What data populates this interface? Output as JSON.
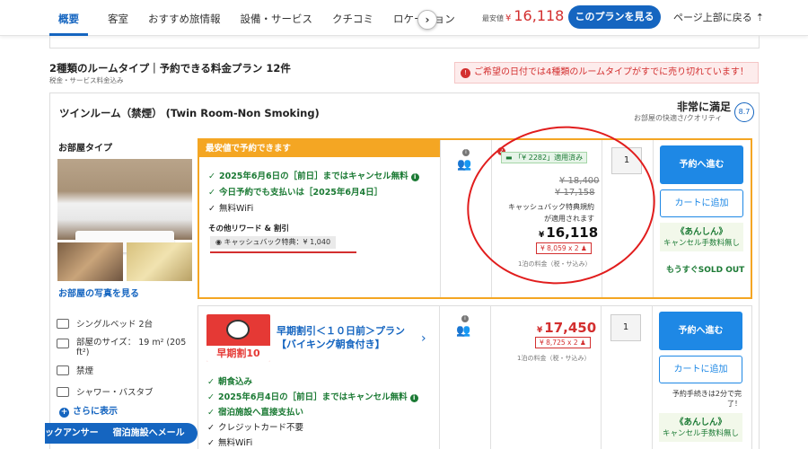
{
  "nav": {
    "tabs": [
      "概要",
      "客室",
      "おすすめ旅情報",
      "設備・サービス",
      "クチコミ",
      "ロケーション"
    ],
    "scroll_icon": "chevron-right-icon",
    "min_price_label": "最安値",
    "min_price_yen": "¥",
    "min_price": "16,118",
    "plan_button": "このプランを見る",
    "to_top": "ページ上部に戻る"
  },
  "summary": {
    "title": "2種類のルームタイプ｜予約できる料金プラン 12件",
    "sub": "税金・サービス料金込み",
    "alert_num": "❷",
    "alert": "ご希望の日付では4種類のルームタイプがすでに売り切れています！"
  },
  "room": {
    "name": "ツインルーム（禁煙） (Twin Room-Non Smoking)",
    "rating_label": "非常に満足",
    "rating_sub": "お部屋の快適さ/クオリティ",
    "rating_score": "8.7",
    "type_label": "お部屋タイプ",
    "photo_link": "お部屋の写真を見る",
    "amenities": [
      "シングルベッド 2台",
      "部屋のサイズ： 19 m² (205",
      "ft²)",
      "禁煙",
      "シャワー・バスタブ"
    ],
    "more_link": "さらに表示"
  },
  "bottom_bar": [
    "ックアンサー",
    "宿泊施設へメール"
  ],
  "plan1": {
    "banner": "最安値で予約できます",
    "features": [
      "2025年6月6日の［前日］まではキャンセル無料",
      "今日予約でも支払いは［2025年6月4日］",
      "無料WiFi"
    ],
    "other_label": "その他リワード & 割引",
    "cashback": "キャッシュバック特典：¥ 1,040",
    "coupon": "「¥ 2282」適用済み",
    "strike1": "¥ 18,400",
    "strike2": "¥ 17,158",
    "note1": "キャッシュバック特典規約",
    "note2": "が適用されます",
    "price_yen": "¥",
    "price": "16,118",
    "per_person": "¥ 8,059 x 2",
    "stay_note": "1泊の料金（税・サ込み）",
    "qty": "1",
    "reserve": "予約へ進む",
    "cart": "カートに追加",
    "anshin_title": "《あんしん》",
    "anshin_sub": "キャンセル手数料無し",
    "soon_sold": "もうすぐSOLD OUT"
  },
  "plan2": {
    "img_text": "早期割10",
    "title_line1": "早期割引＜１０日前＞プラン",
    "title_line2": "【バイキング朝食付き】",
    "features": [
      "朝食込み",
      "2025年6月4日の［前日］まではキャンセル無料",
      "宿泊施設へ直接支払い",
      "クレジットカード不要",
      "無料WiFi"
    ],
    "price_yen": "¥",
    "price": "17,450",
    "per_person": "¥ 8,725 x 2",
    "stay_note": "1泊の料金（税・サ込み）",
    "qty": "1",
    "reserve": "予約へ進む",
    "cart": "カートに追加",
    "proc_note1": "予約手続きは2分で完",
    "proc_note2": "了！",
    "anshin_title": "《あんしん》",
    "anshin_sub": "キャンセル手数料無し"
  },
  "colors": {
    "accent": "#1565c0",
    "price_red": "#d32f2f",
    "best_orange": "#f4a623",
    "green": "#1b7a34"
  }
}
